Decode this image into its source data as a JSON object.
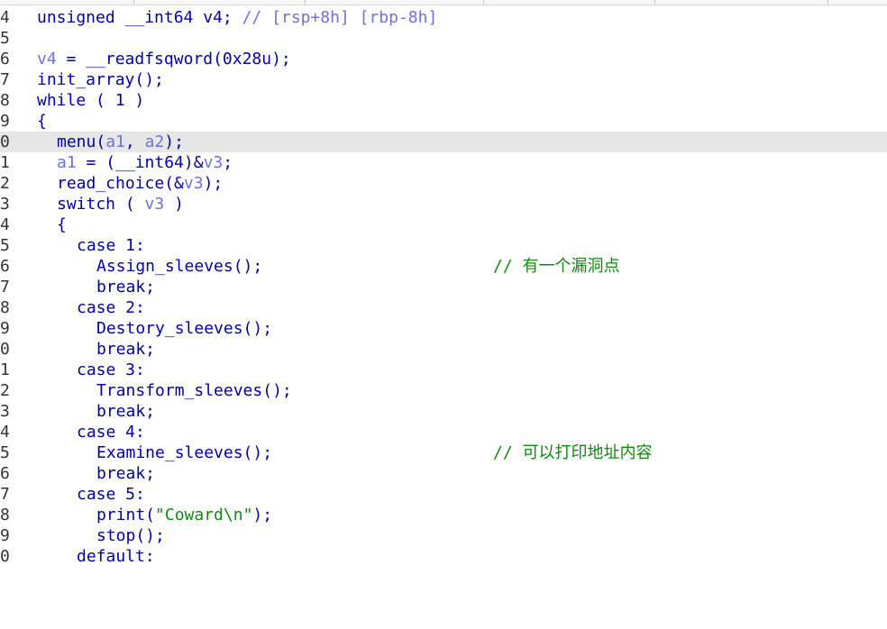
{
  "line_numbers": [
    "4",
    "5",
    "6",
    "7",
    "8",
    "9",
    "0",
    "1",
    "2",
    "3",
    "4",
    "5",
    "6",
    "7",
    "8",
    "9",
    "0",
    "1",
    "2",
    "3",
    "4",
    "5",
    "6",
    "7",
    "8",
    "9",
    "0"
  ],
  "code": {
    "l4_a": "unsigned __int64 v4; ",
    "l4_comment": "// [rsp+8h] [rbp-8h]",
    "l6_var": "v4",
    "l6_rest": " = __readfsqword(0x28u);",
    "l7": "init_array();",
    "l8": "while ( 1 )",
    "l9": "{",
    "l10_fn": "menu(",
    "l10_a1": "a1",
    "l10_sep": ", ",
    "l10_a2": "a2",
    "l10_end": ");",
    "l11_a1": "a1",
    "l11_mid": " = (__int64)&",
    "l11_v3": "v3",
    "l11_end": ";",
    "l12_fn": "read_choice(&",
    "l12_v3": "v3",
    "l12_end": ");",
    "l13_kw": "switch ( ",
    "l13_v3": "v3",
    "l13_end": " )",
    "l14": "{",
    "l15": "case 1:",
    "l16": "Assign_sleeves();",
    "l16_comment": "// 有一个漏洞点",
    "l17": "break;",
    "l18": "case 2:",
    "l19": "Destory_sleeves();",
    "l20": "break;",
    "l21": "case 3:",
    "l22": "Transform_sleeves();",
    "l23": "break;",
    "l24": "case 4:",
    "l25": "Examine_sleeves();",
    "l25_comment": "// 可以打印地址内容",
    "l26": "break;",
    "l27": "case 5:",
    "l28_fn": "print(",
    "l28_str": "\"Coward\\n\"",
    "l28_end": ");",
    "l29": "stop();",
    "l30": "default:"
  },
  "colors": {
    "keyword": "#0000a8",
    "variable": "#7070e0",
    "comment_cn": "#0f8a0f",
    "highlight_line": "#e6e6e6"
  }
}
